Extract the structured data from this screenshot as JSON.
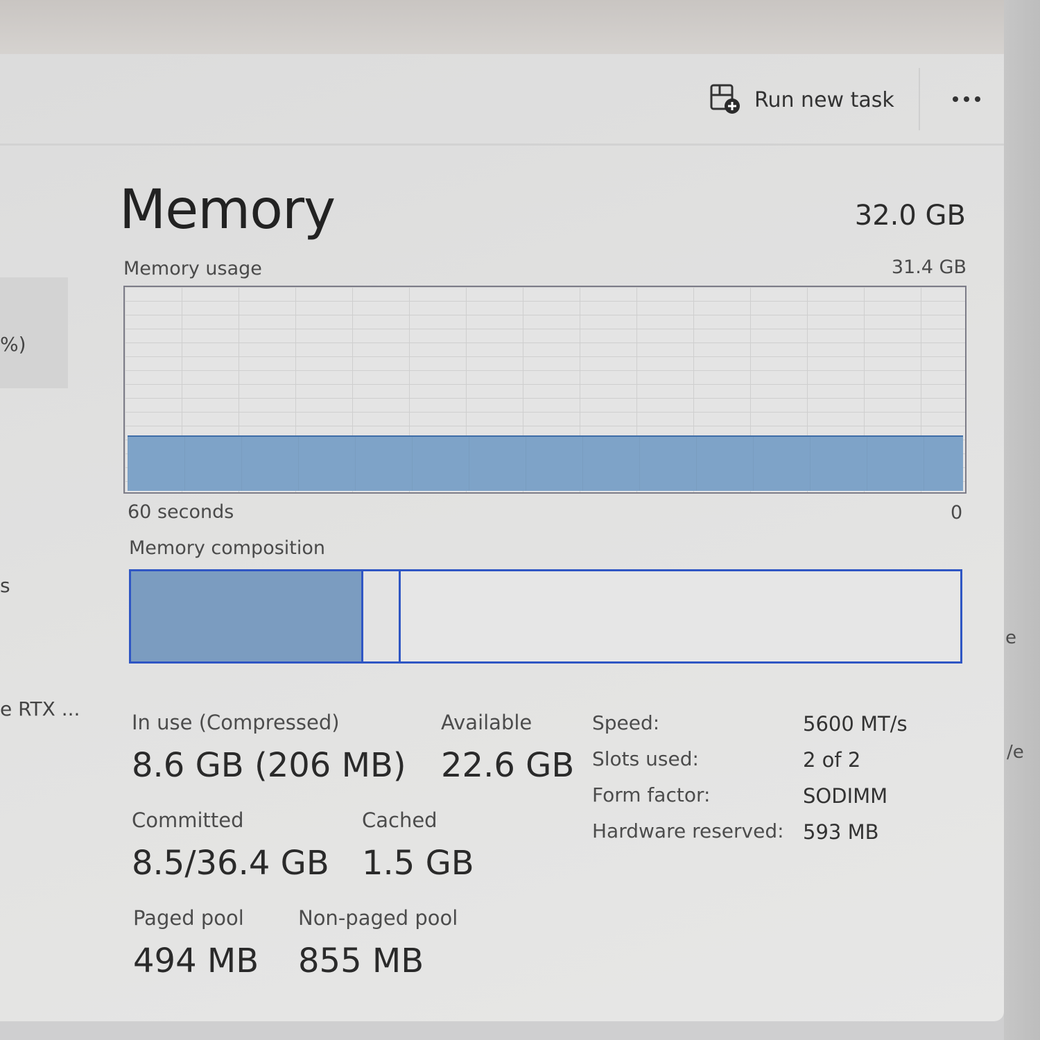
{
  "toolbar": {
    "run_task_label": "Run new task",
    "run_task_icon": "run-task-icon",
    "more_icon": "more-options-icon"
  },
  "sidebar_partial": {
    "percent_fragment": "%)",
    "s_fragment": "s",
    "gpu_fragment": "e RTX ..."
  },
  "right_fragments": {
    "e1": "e",
    "e2": "/e"
  },
  "memory": {
    "title": "Memory",
    "total": "32.0 GB",
    "usage_label": "Memory usage",
    "usage_max": "31.4 GB",
    "time_left": "60 seconds",
    "time_right": "0",
    "usage_fraction": 0.27,
    "composition_label": "Memory composition",
    "composition": {
      "in_use_fraction": 0.28,
      "modified_fraction": 0.045
    },
    "colors": {
      "fill": "#7ea3c8",
      "border": "#2f56c4"
    }
  },
  "stats": {
    "in_use_label": "In use (Compressed)",
    "in_use_value": "8.6 GB (206 MB)",
    "available_label": "Available",
    "available_value": "22.6 GB",
    "committed_label": "Committed",
    "committed_value": "8.5/36.4 GB",
    "cached_label": "Cached",
    "cached_value": "1.5 GB",
    "paged_label": "Paged pool",
    "paged_value": "494 MB",
    "nonpaged_label": "Non-paged pool",
    "nonpaged_value": "855 MB"
  },
  "specs": [
    {
      "key": "Speed:",
      "value": "5600 MT/s"
    },
    {
      "key": "Slots used:",
      "value": "2 of 2"
    },
    {
      "key": "Form factor:",
      "value": "SODIMM"
    },
    {
      "key": "Hardware reserved:",
      "value": "593 MB"
    }
  ]
}
